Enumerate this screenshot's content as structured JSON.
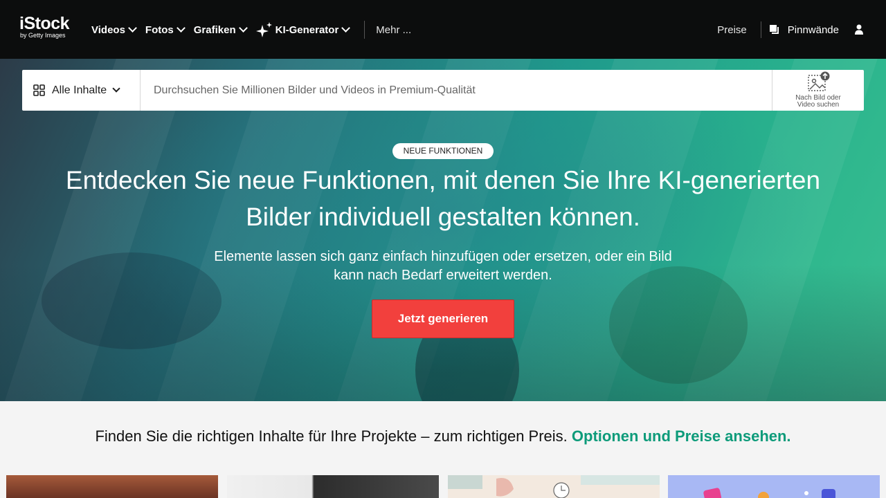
{
  "header": {
    "logo_main": "iStock",
    "logo_sub": "by Getty Images",
    "nav": [
      {
        "label": "Videos"
      },
      {
        "label": "Fotos"
      },
      {
        "label": "Grafiken"
      },
      {
        "label": "KI-Generator"
      }
    ],
    "more_label": "Mehr ...",
    "pricing_label": "Preise",
    "boards_label": "Pinnwände"
  },
  "search": {
    "scope_label": "Alle Inhalte",
    "placeholder": "Durchsuchen Sie Millionen Bilder und Videos in Premium-Qualität",
    "visual_search_line1": "Nach Bild oder",
    "visual_search_line2": "Video suchen"
  },
  "hero": {
    "badge": "NEUE FUNKTIONEN",
    "headline_line1": "Entdecken Sie neue Funktionen, mit denen Sie Ihre KI-generierten",
    "headline_line2": "Bilder individuell gestalten können.",
    "subline_line1": "Elemente lassen sich ganz einfach hinzufügen oder ersetzen, oder ein Bild",
    "subline_line2": "kann nach Bedarf erweitert werden.",
    "cta_label": "Jetzt generieren"
  },
  "promo": {
    "text": "Finden Sie die richtigen Inhalte für Ihre Projekte – zum richtigen Preis. ",
    "link": "Optionen und Preise ansehen."
  },
  "colors": {
    "header_bg": "#0c0d0d",
    "cta": "#f2403d",
    "link_green": "#0d9b7a"
  },
  "icons": [
    "sparkle-icon",
    "boards-icon",
    "user-icon",
    "grid-icon",
    "image-search-icon",
    "chevron-down-icon"
  ]
}
